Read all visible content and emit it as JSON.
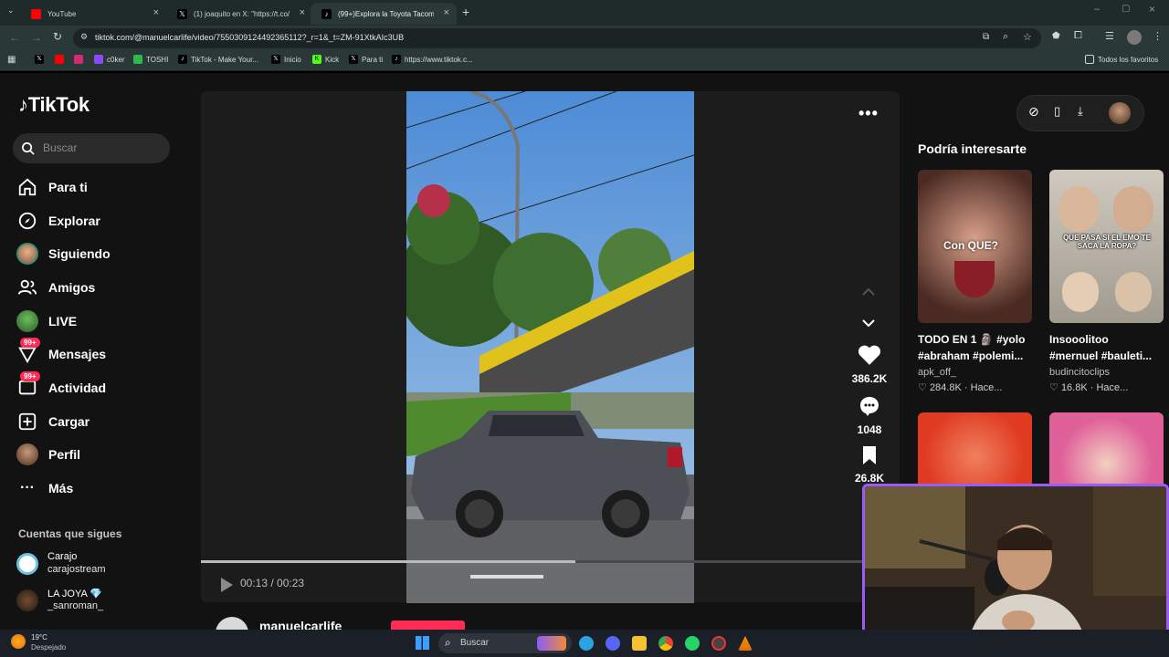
{
  "browser": {
    "tabs": [
      {
        "title": "YouTube"
      },
      {
        "title": "(1) joaquito en X: \"https://t.co/..."
      },
      {
        "title": "(99+)Explora la Toyota Tacoma..."
      }
    ],
    "url": "tiktok.com/@manuelcarlife/video/7550309124492365112?_r=1&_t=ZM-91XtkAIc3UB",
    "bookmarks": [
      {
        "label": ""
      },
      {
        "label": ""
      },
      {
        "label": ""
      },
      {
        "label": "c0ker"
      },
      {
        "label": "TOSHI"
      },
      {
        "label": "TikTok - Make Your..."
      },
      {
        "label": "Inicio"
      },
      {
        "label": "Kick"
      },
      {
        "label": "Para ti"
      },
      {
        "label": "https://www.tiktok.c..."
      }
    ],
    "all_bookmarks": "Todos los favoritos"
  },
  "sidebar": {
    "logo": "TikTok",
    "search_placeholder": "Buscar",
    "items": [
      {
        "label": "Para ti"
      },
      {
        "label": "Explorar"
      },
      {
        "label": "Siguiendo"
      },
      {
        "label": "Amigos"
      },
      {
        "label": "LIVE"
      },
      {
        "label": "Mensajes",
        "badge": "99+"
      },
      {
        "label": "Actividad",
        "badge": "99+"
      },
      {
        "label": "Cargar"
      },
      {
        "label": "Perfil"
      },
      {
        "label": "Más"
      }
    ],
    "following_title": "Cuentas que sigues",
    "following": [
      {
        "name": "Carajo",
        "handle": "carajostream"
      },
      {
        "name": "LA JOYA",
        "handle": "_sanroman_"
      }
    ]
  },
  "video": {
    "time": "00:13 / 00:23",
    "progress": 0.565,
    "likes": "386.2K",
    "comments": "1048",
    "saves": "26.8K",
    "author": "manuelcarlife"
  },
  "recommendations": {
    "title": "Podría interesarte",
    "cards": [
      {
        "title": "TODO EN 1 🗿 #yolo",
        "title2": "#abraham #polemi...",
        "author": "apk_off_",
        "likes": "284.8K",
        "time": "Hace...",
        "thumb_text": "Con QUE?"
      },
      {
        "title": "Insooolitoo",
        "title2": "#mernuel #bauleti...",
        "author": "budincitoclips",
        "likes": "16.8K",
        "time": "Hace...",
        "thumb_text": "QUE PASA SI EL EMO TE SACA LA ROPA?"
      }
    ]
  },
  "taskbar": {
    "weather_temp": "19°C",
    "weather_desc": "Despejado",
    "search_placeholder": "Buscar"
  }
}
